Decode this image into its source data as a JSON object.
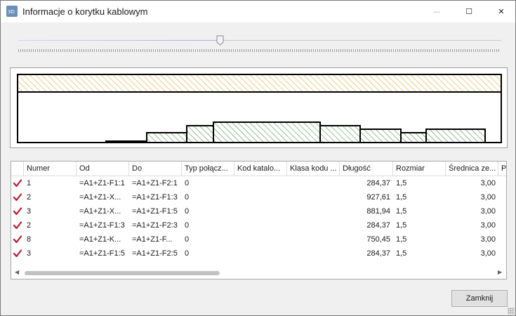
{
  "window": {
    "title": "Informacje o korytku kablowym",
    "app_icon": "3d-app-icon",
    "app_icon_text": "3D",
    "controls": {
      "minimize": "—",
      "maximize": "☐",
      "close": "✕"
    }
  },
  "slider": {
    "value_fraction": 0.42
  },
  "preview": {
    "tray_fill_color": "#e9b64a",
    "cable_fill_color": "#3d8f3d",
    "cable_bundles": [
      {
        "level": 0.03
      },
      {
        "level": 0.19
      },
      {
        "level": 0.34
      },
      {
        "level": 0.4
      },
      {
        "level": 0.34
      },
      {
        "level": 0.27
      },
      {
        "level": 0.19
      },
      {
        "level": 0.27
      }
    ]
  },
  "table": {
    "columns": [
      "Numer",
      "Od",
      "Do",
      "Typ połącz...",
      "Kod katalo...",
      "Klasa kodu ...",
      "Długość",
      "Rozmiar",
      "Średnica ze...",
      "Pr"
    ],
    "rows": [
      {
        "numer": "1",
        "od": "=A1+Z1-F1:1",
        "do": "=A1+Z1-F2:1",
        "typ": "0",
        "kod": "",
        "klasa": "",
        "dlugosc": "284,37",
        "rozmiar": "1,5",
        "srednica": "3,00"
      },
      {
        "numer": "2",
        "od": "=A1+Z1-X...",
        "do": "=A1+Z1-F1:3",
        "typ": "0",
        "kod": "",
        "klasa": "",
        "dlugosc": "927,61",
        "rozmiar": "1,5",
        "srednica": "3,00"
      },
      {
        "numer": "3",
        "od": "=A1+Z1-X...",
        "do": "=A1+Z1-F1:5",
        "typ": "0",
        "kod": "",
        "klasa": "",
        "dlugosc": "881,94",
        "rozmiar": "1,5",
        "srednica": "3,00"
      },
      {
        "numer": "2",
        "od": "=A1+Z1-F1:3",
        "do": "=A1+Z1-F2:3",
        "typ": "0",
        "kod": "",
        "klasa": "",
        "dlugosc": "284,37",
        "rozmiar": "1,5",
        "srednica": "3,00"
      },
      {
        "numer": "8",
        "od": "=A1+Z1-K...",
        "do": "=A1+Z1-F...",
        "typ": "0",
        "kod": "",
        "klasa": "",
        "dlugosc": "750,45",
        "rozmiar": "1,5",
        "srednica": "3,00"
      },
      {
        "numer": "3",
        "od": "=A1+Z1-F1:5",
        "do": "=A1+Z1-F2:5",
        "typ": "0",
        "kod": "",
        "klasa": "",
        "dlugosc": "284,37",
        "rozmiar": "1,5",
        "srednica": "3,00"
      }
    ],
    "check_icon": "checkmark-icon",
    "check_color": "#c0182a"
  },
  "buttons": {
    "close_label": "Zamknij"
  }
}
